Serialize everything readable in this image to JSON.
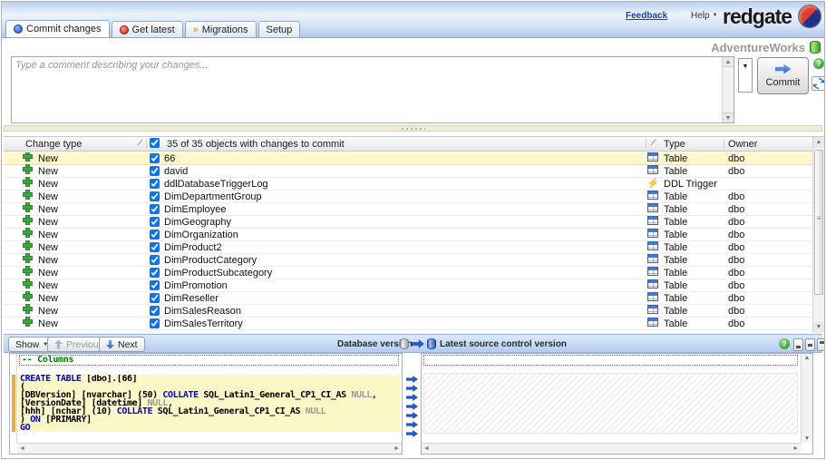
{
  "header": {
    "feedback": "Feedback",
    "help": "Help",
    "logo": "redgate"
  },
  "tabs": [
    {
      "label": "Commit changes"
    },
    {
      "label": "Get latest"
    },
    {
      "label": "Migrations"
    },
    {
      "label": "Setup"
    }
  ],
  "database_name": "AdventureWorks",
  "commit_panel": {
    "comment_placeholder": "Type a comment describing your changes...",
    "commit_label": "Commit"
  },
  "grid": {
    "header": {
      "change_type": "Change type",
      "objects": "35 of 35 objects with changes to commit",
      "type": "Type",
      "owner": "Owner",
      "select_all_checked": true
    },
    "rows": [
      {
        "change_type": "New",
        "checked": true,
        "name": "66",
        "type": "Table",
        "icon": "table",
        "owner": "dbo",
        "selected": true
      },
      {
        "change_type": "New",
        "checked": true,
        "name": "david",
        "type": "Table",
        "icon": "table",
        "owner": "dbo",
        "selected": false
      },
      {
        "change_type": "New",
        "checked": true,
        "name": "ddlDatabaseTriggerLog",
        "type": "DDL Trigger",
        "icon": "trigger",
        "owner": "",
        "selected": false
      },
      {
        "change_type": "New",
        "checked": true,
        "name": "DimDepartmentGroup",
        "type": "Table",
        "icon": "table",
        "owner": "dbo",
        "selected": false
      },
      {
        "change_type": "New",
        "checked": true,
        "name": "DimEmployee",
        "type": "Table",
        "icon": "table",
        "owner": "dbo",
        "selected": false
      },
      {
        "change_type": "New",
        "checked": true,
        "name": "DimGeography",
        "type": "Table",
        "icon": "table",
        "owner": "dbo",
        "selected": false
      },
      {
        "change_type": "New",
        "checked": true,
        "name": "DimOrganization",
        "type": "Table",
        "icon": "table",
        "owner": "dbo",
        "selected": false
      },
      {
        "change_type": "New",
        "checked": true,
        "name": "DimProduct2",
        "type": "Table",
        "icon": "table",
        "owner": "dbo",
        "selected": false
      },
      {
        "change_type": "New",
        "checked": true,
        "name": "DimProductCategory",
        "type": "Table",
        "icon": "table",
        "owner": "dbo",
        "selected": false
      },
      {
        "change_type": "New",
        "checked": true,
        "name": "DimProductSubcategory",
        "type": "Table",
        "icon": "table",
        "owner": "dbo",
        "selected": false
      },
      {
        "change_type": "New",
        "checked": true,
        "name": "DimPromotion",
        "type": "Table",
        "icon": "table",
        "owner": "dbo",
        "selected": false
      },
      {
        "change_type": "New",
        "checked": true,
        "name": "DimReseller",
        "type": "Table",
        "icon": "table",
        "owner": "dbo",
        "selected": false
      },
      {
        "change_type": "New",
        "checked": true,
        "name": "DimSalesReason",
        "type": "Table",
        "icon": "table",
        "owner": "dbo",
        "selected": false
      },
      {
        "change_type": "New",
        "checked": true,
        "name": "DimSalesTerritory",
        "type": "Table",
        "icon": "table",
        "owner": "dbo",
        "selected": false
      }
    ]
  },
  "diff": {
    "toolbar": {
      "show": "Show",
      "previous": "Previous",
      "next": "Next",
      "left_version": "Database version",
      "right_version": "Latest source control version"
    },
    "region_line": "-- Columns",
    "changed_lines": [
      [
        [
          "CREATE",
          "kw"
        ],
        [
          " ",
          "pl"
        ],
        [
          "TABLE",
          "kw"
        ],
        [
          " [dbo].[66]",
          "pl"
        ]
      ],
      [
        [
          "(",
          "pl"
        ]
      ],
      [
        [
          "[DBVersion] [nvarchar] (50) ",
          "pl"
        ],
        [
          "COLLATE",
          "kw"
        ],
        [
          " SQL_Latin1_General_CP1_CI_AS ",
          "pl"
        ],
        [
          "NULL",
          "gr"
        ],
        [
          ",",
          "pl"
        ]
      ],
      [
        [
          "[VersionDate] [datetime] ",
          "pl"
        ],
        [
          "NULL",
          "gr"
        ],
        [
          ",",
          "pl"
        ]
      ],
      [
        [
          "[hhh] [nchar] (10) ",
          "pl"
        ],
        [
          "COLLATE",
          "kw"
        ],
        [
          " SQL_Latin1_General_CP1_CI_AS ",
          "pl"
        ],
        [
          "NULL",
          "gr"
        ]
      ],
      [
        [
          ") ",
          "pl"
        ],
        [
          "ON",
          "kw"
        ],
        [
          " [PRIMARY]",
          "pl"
        ]
      ],
      [
        [
          "GO",
          "kw"
        ]
      ]
    ],
    "gutter_arrows": 7
  },
  "colors": {
    "accent_blue": "#2a5ed0",
    "selected_row": "#fcf8cb",
    "changed_block": "#fbf7c6",
    "keyword": "#0000e6",
    "comment_green": "#008000",
    "muted_gray": "#9a9a9a",
    "marker_orange": "#f5a63c"
  }
}
